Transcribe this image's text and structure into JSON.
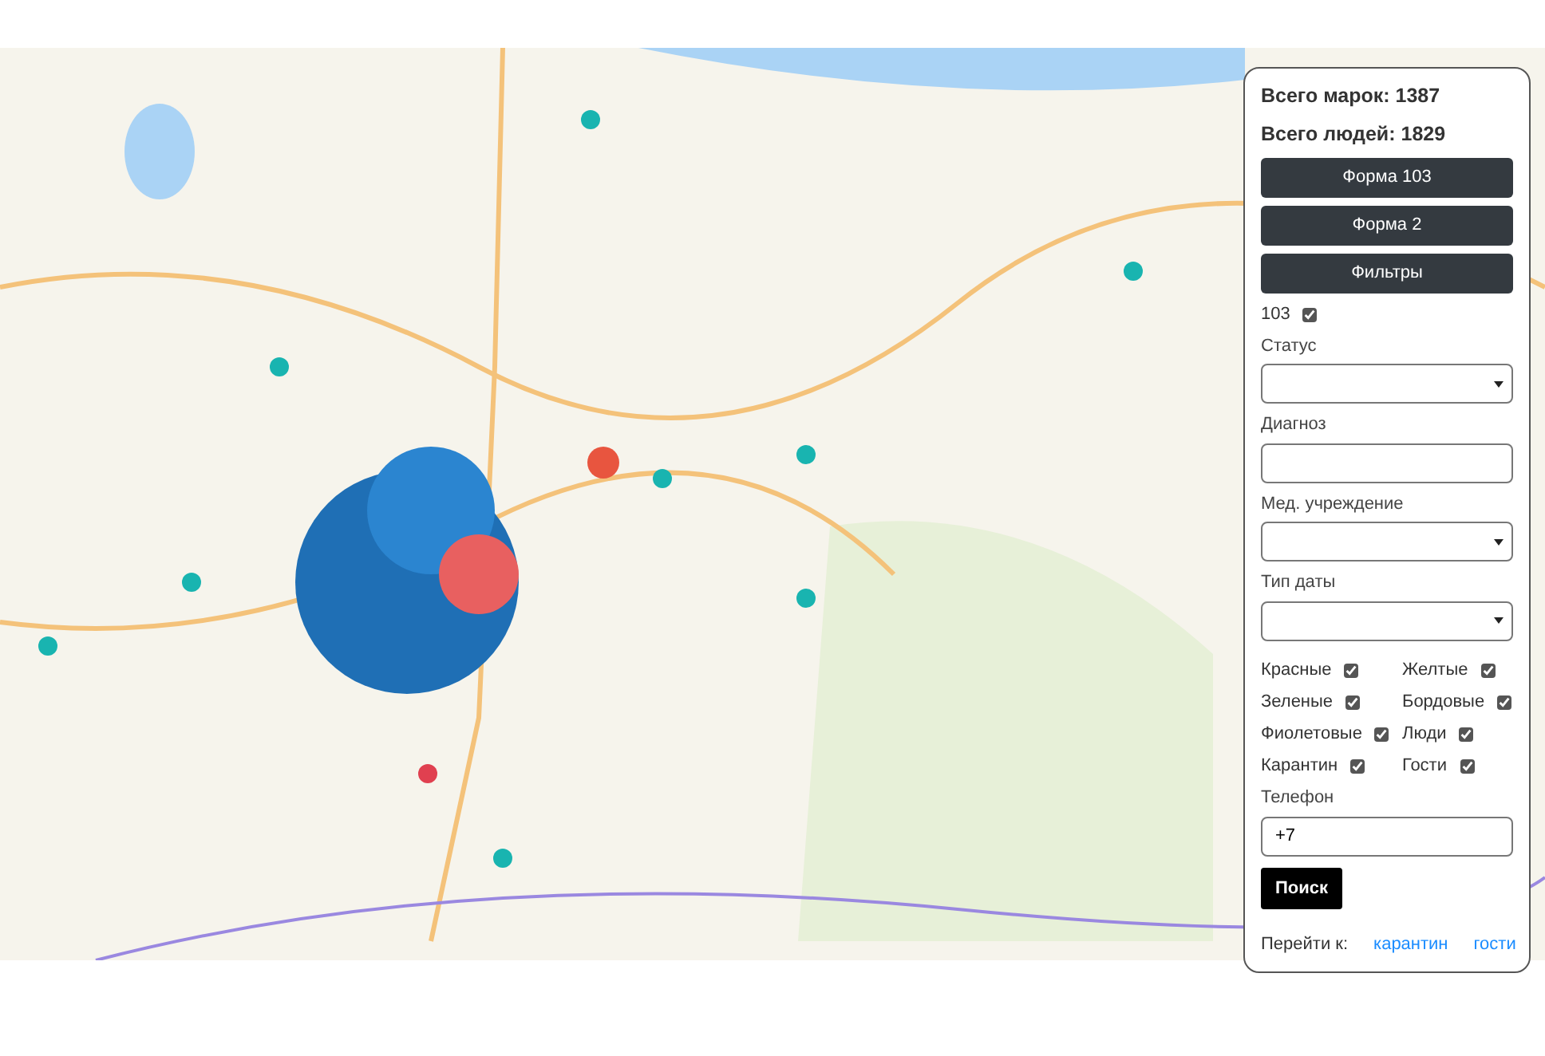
{
  "panel": {
    "total_marks": "Всего марок: 1387",
    "total_people": "Всего людей: 1829",
    "buttons": [
      "Форма 103",
      "Форма 2",
      "Фильтры"
    ],
    "toggle_103": {
      "label": "103",
      "checked": true
    },
    "status": {
      "label": "Статус"
    },
    "diagnosis": {
      "label": "Диагноз"
    },
    "institution": {
      "label": "Мед. учреждение"
    },
    "date_type": {
      "label": "Тип даты"
    },
    "filters": [
      {
        "label": "Красные",
        "checked": true
      },
      {
        "label": "Желтые",
        "checked": true
      },
      {
        "label": "Зеленые",
        "checked": true
      },
      {
        "label": "Бордовые",
        "checked": true
      },
      {
        "label": "Фиолетовые",
        "checked": true
      },
      {
        "label": "Люди",
        "checked": true
      },
      {
        "label": "Карантин",
        "checked": true
      },
      {
        "label": "Гости",
        "checked": true
      }
    ],
    "phone": {
      "label": "Телефон",
      "value": "+7"
    },
    "search_button": "Поиск",
    "goto": {
      "label": "Перейти к:",
      "links": [
        "карантин",
        "гости"
      ]
    }
  }
}
